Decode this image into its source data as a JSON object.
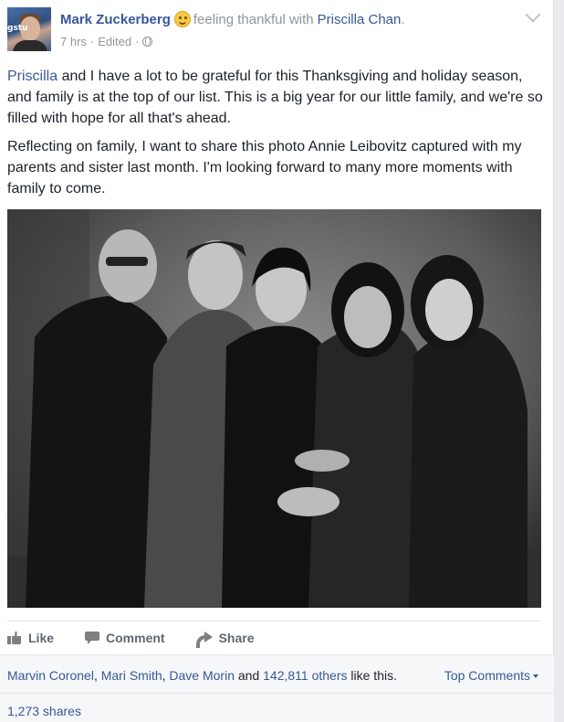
{
  "post": {
    "author": "Mark Zuckerberg",
    "feeling": "feeling thankful with",
    "tagged": "Priscilla Chan",
    "period": ".",
    "time": "7 hrs",
    "sep": "·",
    "edited": "Edited",
    "sep2": "·",
    "avatar_tag": "gstu",
    "paragraph1": {
      "mention": "Priscilla",
      "rest": " and I have a lot to be grateful for this Thanksgiving and holiday season, and family is at the top of our list. This is a big year for our little family, and we're so filled with hope for all that's ahead."
    },
    "paragraph2": "Reflecting on family, I want to share this photo Annie Leibovitz captured with my parents and sister last month. I'm looking forward to many more moments with family to come."
  },
  "actions": {
    "like": "Like",
    "comment": "Comment",
    "share": "Share"
  },
  "engagement": {
    "liker1": "Marvin Coronel",
    "sep1": ", ",
    "liker2": "Mari Smith",
    "sep2": ", ",
    "liker3": "Dave Morin",
    "and": " and ",
    "others": "142,811 others",
    "suffix": " like this.",
    "top_comments": "Top Comments",
    "shares": "1,273 shares"
  },
  "colors": {
    "link": "#365899",
    "muted": "#90949c",
    "action": "#616770"
  }
}
